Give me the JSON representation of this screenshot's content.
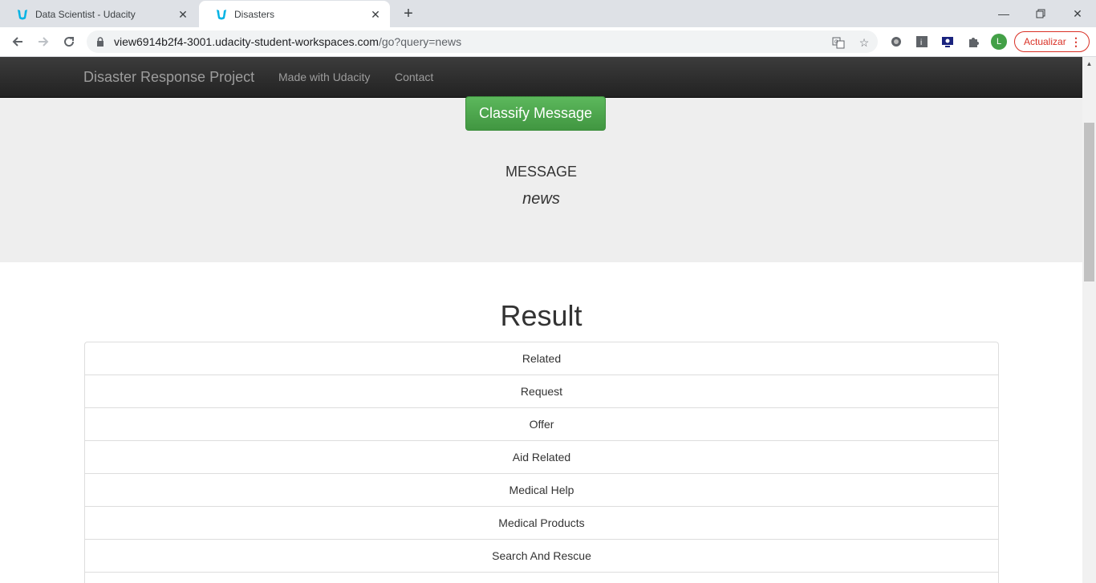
{
  "browser": {
    "tabs": [
      {
        "title": "Data Scientist - Udacity",
        "active": false
      },
      {
        "title": "Disasters",
        "active": true
      }
    ],
    "url_host": "view6914b2f4-3001.udacity-student-workspaces.com",
    "url_path": "/go?query=news",
    "update_label": "Actualizar",
    "profile_initial": "L",
    "colors": {
      "udacity_logo": "#02b3e4",
      "update": "#d93025",
      "avatar": "#43a047"
    }
  },
  "navbar": {
    "brand": "Disaster Response Project",
    "links": [
      "Made with Udacity",
      "Contact"
    ]
  },
  "jumbotron": {
    "button_label": "Classify Message",
    "message_label": "MESSAGE",
    "message_text": "news"
  },
  "result": {
    "title": "Result",
    "categories": [
      "Related",
      "Request",
      "Offer",
      "Aid Related",
      "Medical Help",
      "Medical Products",
      "Search And Rescue",
      ""
    ]
  }
}
